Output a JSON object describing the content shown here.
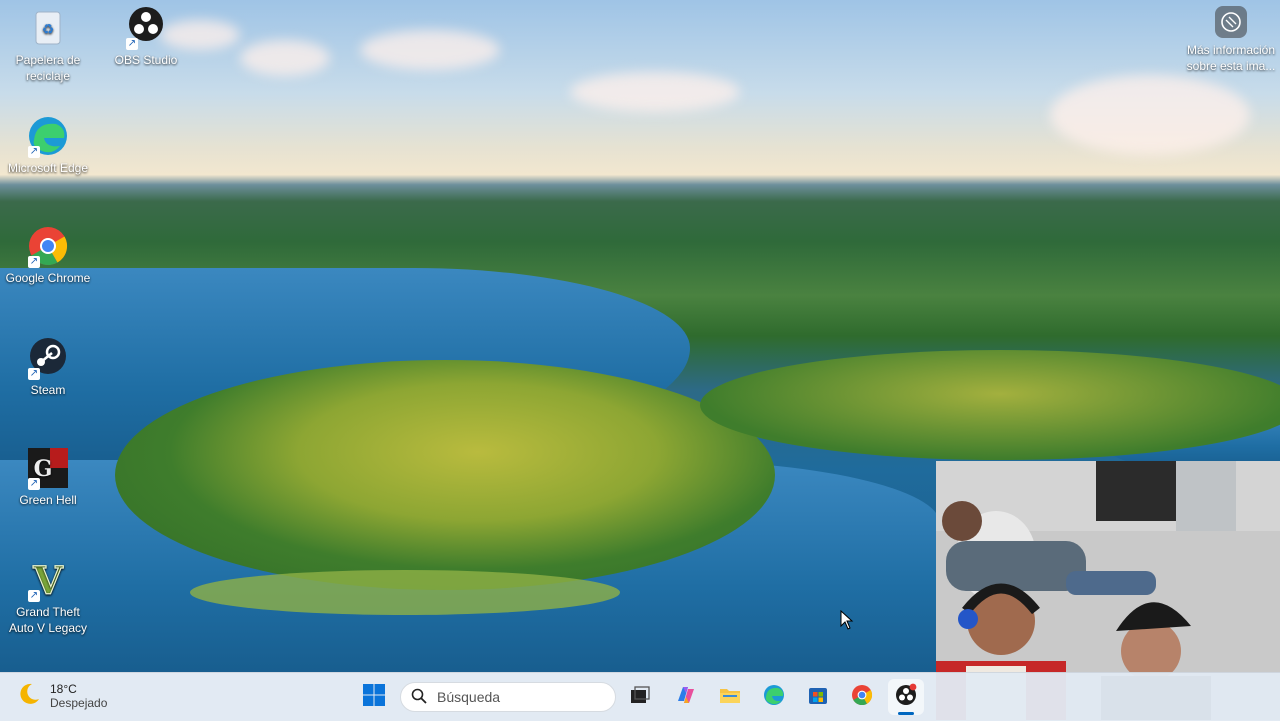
{
  "desktop": {
    "icons": [
      {
        "label": "Papelera de reciclaje",
        "icon": "recycle-bin-icon"
      },
      {
        "label": "OBS Studio",
        "icon": "obs-studio-icon"
      },
      {
        "label": "Microsoft Edge",
        "icon": "edge-icon"
      },
      {
        "label": "Google Chrome",
        "icon": "chrome-icon"
      },
      {
        "label": "Steam",
        "icon": "steam-icon"
      },
      {
        "label": "Green Hell",
        "icon": "green-hell-icon"
      },
      {
        "label": "Grand Theft Auto V Legacy",
        "icon": "gta-v-icon"
      }
    ],
    "info_button": {
      "label": "Más información sobre esta ima..."
    }
  },
  "taskbar": {
    "weather": {
      "temp": "18°C",
      "condition": "Despejado"
    },
    "search": {
      "placeholder": "Búsqueda"
    },
    "apps": [
      "windows-start-icon",
      "task-view-icon",
      "copilot-icon",
      "file-explorer-icon",
      "edge-icon",
      "microsoft-store-icon",
      "chrome-icon",
      "obs-studio-icon"
    ]
  },
  "colors": {
    "accent": "#0067c0",
    "taskbar_bg": "#e1e9f2"
  }
}
